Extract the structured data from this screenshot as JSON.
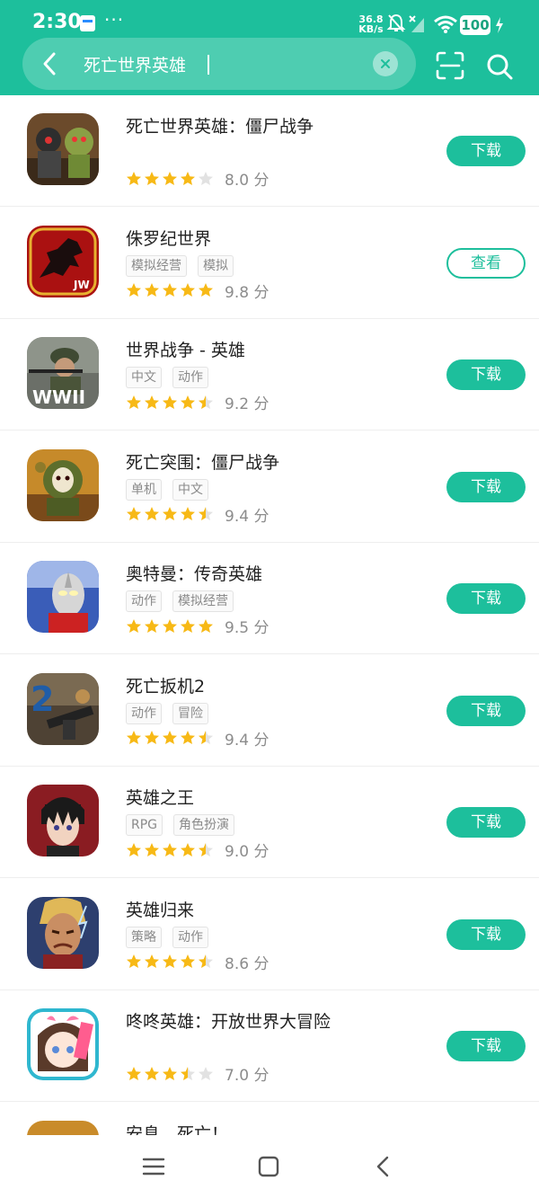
{
  "status_bar": {
    "time": "2:30",
    "dots": "···",
    "net_speed_value": "36.8",
    "net_speed_unit": "KB/s",
    "battery": "100"
  },
  "search": {
    "query": "死亡世界英雄"
  },
  "colors": {
    "accent": "#1dbf9c",
    "star_on": "#f7b916",
    "star_off": "#e2e2e2"
  },
  "apps": [
    {
      "name": "死亡世界英雄：僵尸战争",
      "tags": [],
      "rating": 4,
      "score": "8.0 分",
      "action": "下载",
      "icon": "zombie-soldier-icon"
    },
    {
      "name": "侏罗纪世界",
      "tags": [
        "模拟经营",
        "模拟"
      ],
      "rating": 5,
      "score": "9.8 分",
      "action": "查看",
      "icon": "jurassic-world-icon"
    },
    {
      "name": "世界战争 - 英雄",
      "tags": [
        "中文",
        "动作"
      ],
      "rating": 4.5,
      "score": "9.2 分",
      "action": "下载",
      "icon": "wwii-soldier-icon"
    },
    {
      "name": "死亡突围：僵尸战争",
      "tags": [
        "单机",
        "中文"
      ],
      "rating": 4.5,
      "score": "9.4 分",
      "action": "下载",
      "icon": "zombie-hockey-mask-icon"
    },
    {
      "name": "奥特曼：传奇英雄",
      "tags": [
        "动作",
        "模拟经营"
      ],
      "rating": 5,
      "score": "9.5 分",
      "action": "下载",
      "icon": "ultraman-icon"
    },
    {
      "name": "死亡扳机2",
      "tags": [
        "动作",
        "冒险"
      ],
      "rating": 4.5,
      "score": "9.4 分",
      "action": "下载",
      "icon": "dead-trigger-icon"
    },
    {
      "name": "英雄之王",
      "tags": [
        "RPG",
        "角色扮演"
      ],
      "rating": 4.5,
      "score": "9.0 分",
      "action": "下载",
      "icon": "anime-hero-icon"
    },
    {
      "name": "英雄归来",
      "tags": [
        "策略",
        "动作"
      ],
      "rating": 4.5,
      "score": "8.6 分",
      "action": "下载",
      "icon": "thunder-god-icon"
    },
    {
      "name": "咚咚英雄：开放世界大冒险",
      "tags": [],
      "rating": 3.5,
      "score": "7.0 分",
      "action": "下载",
      "icon": "anime-girl-icon"
    },
    {
      "name": "安息，死亡！",
      "tags": [],
      "rating": 0,
      "score": "",
      "action": "",
      "icon": "grim-reaper-icon"
    }
  ]
}
